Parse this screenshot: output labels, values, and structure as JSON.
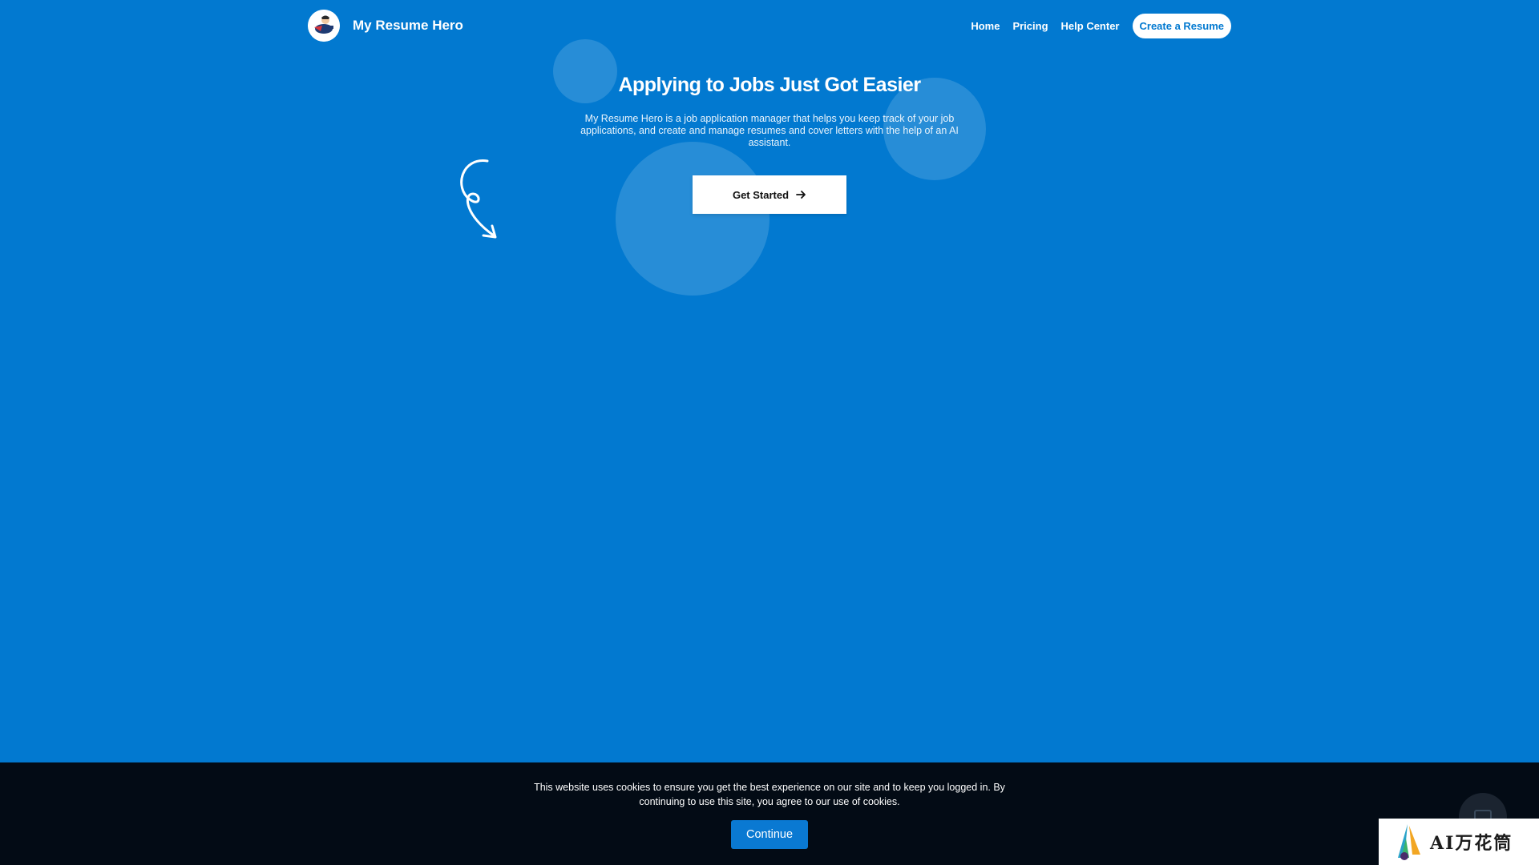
{
  "nav": {
    "brand": "My Resume Hero",
    "avatar_icon": "hero-avatar-icon",
    "links": [
      {
        "label": "Home"
      },
      {
        "label": "Pricing"
      },
      {
        "label": "Help Center"
      }
    ],
    "cta_label": "Create a Resume"
  },
  "hero": {
    "title": "Applying to Jobs Just Got Easier",
    "subtitle": "My Resume Hero is a job application manager that helps you keep track of your job applications, and create and manage resumes and cover letters with the help of an AI assistant.",
    "button_label": "Get Started",
    "button_icon": "arrow-right-icon",
    "decor_icon": "curly-arrow-icon"
  },
  "cookie": {
    "text": "This website uses cookies to ensure you get the best experience on our site and to keep you logged in. By continuing to use this site, you agree to our use of cookies.",
    "button_label": "Continue"
  },
  "chat": {
    "icon": "chat-icon"
  },
  "watermark": {
    "text": "AI万花筒"
  },
  "colors": {
    "background": "#0279d0",
    "cookie_bar": "#030b15",
    "cookie_button": "#0a79d2",
    "cta_text": "#0279d0"
  }
}
